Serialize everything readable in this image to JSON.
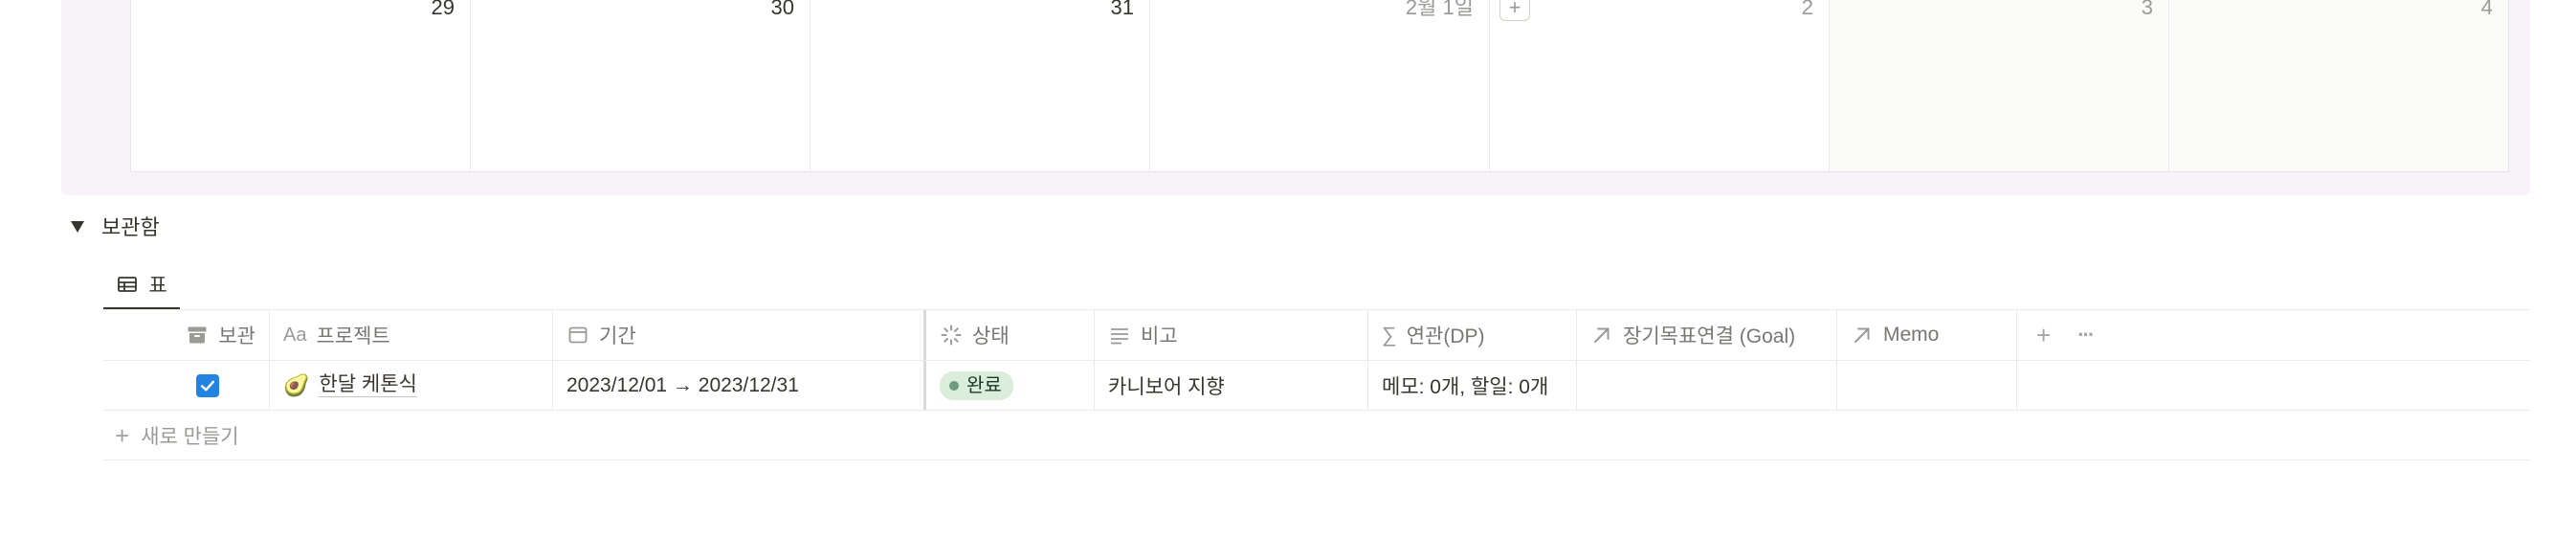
{
  "calendar": {
    "days": [
      {
        "label": "29",
        "muted": false,
        "weekend": false,
        "has_add": false
      },
      {
        "label": "30",
        "muted": false,
        "weekend": false,
        "has_add": false
      },
      {
        "label": "31",
        "muted": false,
        "weekend": false,
        "has_add": false
      },
      {
        "label": "2월 1일",
        "muted": true,
        "weekend": false,
        "has_add": false
      },
      {
        "label": "2",
        "muted": true,
        "weekend": false,
        "has_add": true
      },
      {
        "label": "3",
        "muted": true,
        "weekend": true,
        "has_add": false
      },
      {
        "label": "4",
        "muted": true,
        "weekend": true,
        "has_add": false
      }
    ],
    "add_glyph": "+"
  },
  "toggle": {
    "title": "보관함"
  },
  "view_tab": {
    "label": "표",
    "icon": "table-icon"
  },
  "table": {
    "columns": [
      {
        "label": "보관",
        "icon": "archive-icon"
      },
      {
        "label": "프로젝트",
        "icon": "text-aa-icon"
      },
      {
        "label": "기간",
        "icon": "calendar-icon"
      },
      {
        "label": "상태",
        "icon": "status-spinner-icon"
      },
      {
        "label": "비고",
        "icon": "lines-icon"
      },
      {
        "label": "연관(DP)",
        "icon": "sigma-icon"
      },
      {
        "label": "장기목표연결 (Goal)",
        "icon": "arrow-up-right-icon"
      },
      {
        "label": "Memo",
        "icon": "arrow-up-right-icon"
      }
    ],
    "rows": [
      {
        "archived": true,
        "emoji": "🥑",
        "project": "한달 케톤식",
        "period": "2023/12/01 → 2023/12/31",
        "status": "완료",
        "note": "카니보어 지향",
        "related": "메모: 0개, 할일: 0개",
        "goal": "",
        "memo": ""
      }
    ],
    "add_column_glyph": "+",
    "more_glyph": "···",
    "new_row_label": "새로 만들기",
    "new_row_glyph": "+"
  }
}
